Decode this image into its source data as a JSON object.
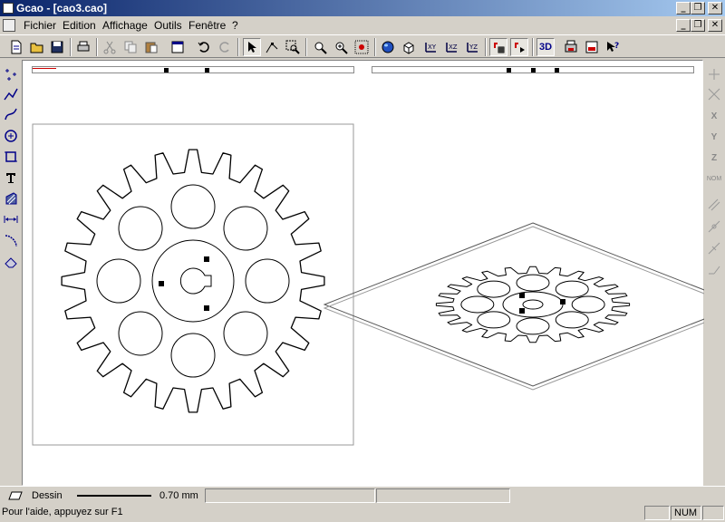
{
  "window": {
    "title": "Gcao - [cao3.cao]",
    "minimize_glyph": "_",
    "restore_glyph": "❐",
    "close_glyph": "✕"
  },
  "menu": {
    "items": [
      "Fichier",
      "Edition",
      "Affichage",
      "Outils",
      "Fenêtre",
      "?"
    ]
  },
  "toolbar": {
    "label_3d": "3D",
    "icons": [
      "new-icon",
      "open-icon",
      "save-icon",
      "print-icon",
      "cut-icon",
      "copy-icon",
      "paste-icon",
      "properties-icon",
      "undo-icon",
      "redo-icon",
      "select-arrow-icon",
      "node-edit-icon",
      "zoom-window-icon",
      "zoom-all-icon",
      "zoom-realtime-icon",
      "zoom-previous-icon",
      "globe-render-icon",
      "box-view-icon",
      "xy-plane-icon",
      "xz-plane-icon",
      "xy-axes-icon",
      "yz-plane-icon",
      "snap-grid-icon",
      "snap-magnet-icon",
      "3d-view-icon",
      "3d-print-icon",
      "3d-export-icon",
      "help-pointer-icon"
    ]
  },
  "left_tools": [
    "point-icon",
    "polyline-icon",
    "curve-icon",
    "circle-icon",
    "rectangle-icon",
    "text-icon",
    "hatch-icon",
    "dimension-icon",
    "fillet-icon",
    "eraser-icon"
  ],
  "right_tools": [
    "snap-point-icon",
    "snap-intersection-icon",
    "rotate-x-icon",
    "rotate-y-icon",
    "rotate-z-icon",
    "normal-view-icon",
    "parallel-line-icon",
    "snap-tangent-icon",
    "perpendicular-icon",
    "extend-line-icon"
  ],
  "right_tools_labels": {
    "rotate_x": "X",
    "rotate_y": "Y",
    "rotate_z": "Z",
    "normal": "NOM"
  },
  "status": {
    "layer_label": "Dessin",
    "line_width": "0.70 mm",
    "help_text": "Pour l'aide, appuyez sur F1",
    "num_indicator": "NUM"
  },
  "drawing": {
    "gear_teeth": 24,
    "gear_holes": 8,
    "colors": {
      "canvas": "#ffffff",
      "line": "#000000",
      "title_start": "#0a246a",
      "title_end": "#a6caf0"
    }
  }
}
